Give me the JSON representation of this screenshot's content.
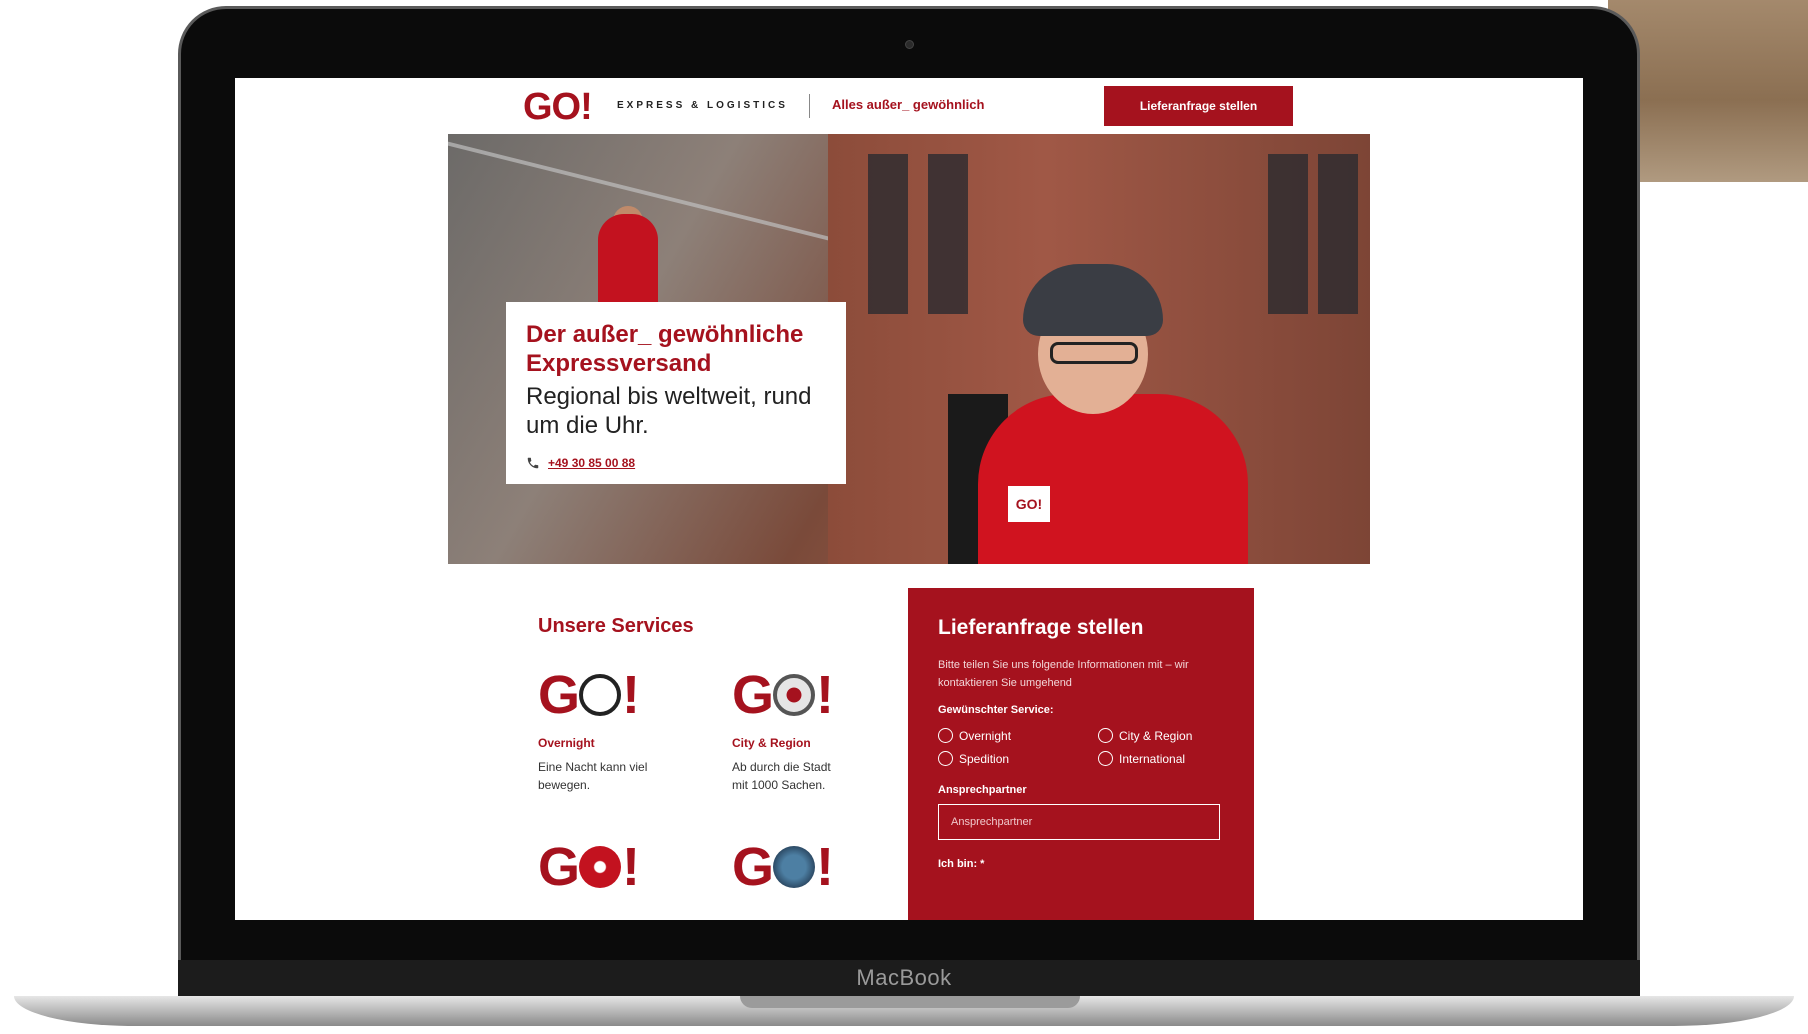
{
  "device": {
    "label": "MacBook"
  },
  "header": {
    "logo": "GO!",
    "logo_sub": "EXPRESS & LOGISTICS",
    "tagline": "Alles außer_ gewöhnlich",
    "cta_label": "Lieferanfrage stellen"
  },
  "hero": {
    "title": "Der außer_ gewöhnliche Expressversand",
    "subtitle": "Regional bis weltweit, rund um die Uhr.",
    "phone": "+49 30 85 00 88",
    "badge": "GO!"
  },
  "services": {
    "title": "Unsere Services",
    "items": [
      {
        "logo": "GO!",
        "name": "Overnight",
        "desc": "Eine Nacht kann viel bewegen."
      },
      {
        "logo": "GO!",
        "name": "City & Region",
        "desc": "Ab durch die Stadt mit 1000 Sachen."
      },
      {
        "logo": "GO!"
      },
      {
        "logo": "GO!"
      }
    ]
  },
  "form": {
    "title": "Lieferanfrage stellen",
    "intro": "Bitte teilen Sie uns folgende Informationen mit – wir kontaktieren Sie umgehend",
    "service_label": "Gewünschter Service:",
    "options": [
      "Overnight",
      "City & Region",
      "Spedition",
      "International"
    ],
    "contact_label": "Ansprechpartner",
    "contact_placeholder": "Ansprechpartner",
    "role_label": "Ich bin: *"
  },
  "colors": {
    "brand": "#a5121e",
    "panel": "#a5121e"
  }
}
